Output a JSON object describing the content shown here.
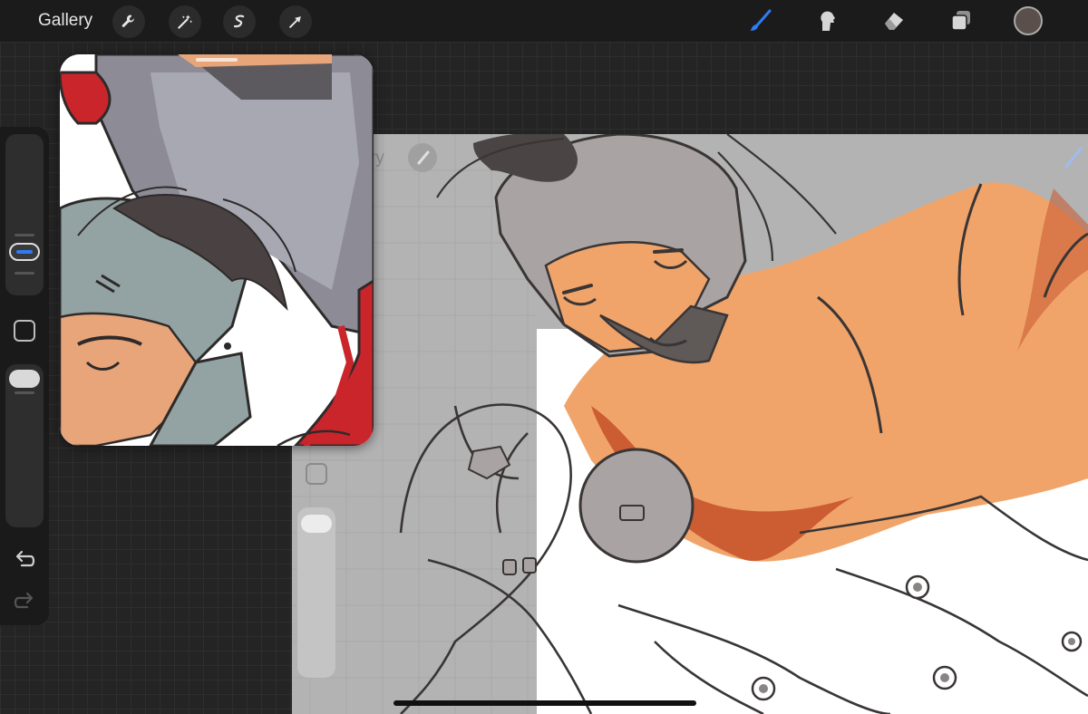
{
  "topbar": {
    "gallery_label": "Gallery",
    "left_tools": [
      "wrench-icon",
      "magic-wand-icon",
      "selection-icon",
      "transform-arrow-icon"
    ],
    "right_tools": [
      "brush-icon",
      "smudge-icon",
      "eraser-icon",
      "layers-icon"
    ],
    "active_tool": "brush-icon",
    "accent_color": "#2f7bf5",
    "current_color": "#5a4f4b"
  },
  "sidebar": {
    "brush_size_level": 0.72,
    "opacity_level": 1.0,
    "undo_icon": "undo-icon",
    "redo_icon": "redo-icon"
  },
  "canvas_overlay": {
    "partial_gallery_text": "ry"
  },
  "colors": {
    "skin": "#f0a46a",
    "shadow_red": "#c8552e",
    "armor": "#a9a4a3",
    "hair": "#4a4444",
    "line": "#3a3535",
    "red_suit": "#d32323"
  }
}
